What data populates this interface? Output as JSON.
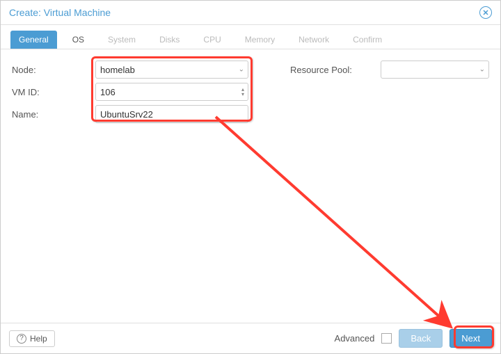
{
  "window": {
    "title": "Create: Virtual Machine"
  },
  "tabs": [
    {
      "label": "General",
      "state": "active"
    },
    {
      "label": "OS",
      "state": "available"
    },
    {
      "label": "System",
      "state": "disabled"
    },
    {
      "label": "Disks",
      "state": "disabled"
    },
    {
      "label": "CPU",
      "state": "disabled"
    },
    {
      "label": "Memory",
      "state": "disabled"
    },
    {
      "label": "Network",
      "state": "disabled"
    },
    {
      "label": "Confirm",
      "state": "disabled"
    }
  ],
  "form": {
    "node_label": "Node:",
    "node_value": "homelab",
    "vmid_label": "VM ID:",
    "vmid_value": "106",
    "name_label": "Name:",
    "name_value": "UbuntuSrv22",
    "pool_label": "Resource Pool:",
    "pool_value": ""
  },
  "footer": {
    "help": "Help",
    "advanced": "Advanced",
    "back": "Back",
    "next": "Next"
  },
  "colors": {
    "accent": "#4b9cd3",
    "highlight": "#ff3b30"
  }
}
